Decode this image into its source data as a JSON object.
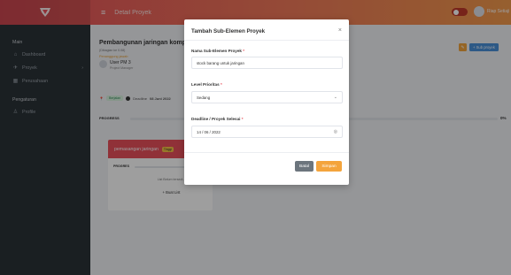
{
  "header": {
    "title": "Detail Proyek",
    "user_name": "Riap Setiaji"
  },
  "sidebar": {
    "sections": [
      "Main",
      "Pengaturan"
    ],
    "items": [
      {
        "label": "Dashboard",
        "icon": "home-icon"
      },
      {
        "label": "Proyek",
        "icon": "rocket-icon"
      },
      {
        "label": "Perusahaan",
        "icon": "building-icon"
      },
      {
        "label": "Profile",
        "icon": "user-icon"
      }
    ]
  },
  "main": {
    "project_title": "Pembangunan jaringan komput",
    "project_sub": "(Dibagian ke 0.08)",
    "manager_label": "Penanggung jawab",
    "manager_name": "User PM 3",
    "manager_role": "Project Manager",
    "status": "Berjalan",
    "deadline_prefix": "Deadline",
    "deadline": "08 Juni 2022",
    "progress_label": "PROGRESS",
    "progress_pct": "0%",
    "progress_value": 0,
    "add_sub_button": "+ Sub proyek",
    "card": {
      "title": "pemasangan jaringan",
      "tag": "Tinggi",
      "progress_label": "PROGRES",
      "empty_text": "List Belum tersedi...",
      "add_list": "+ Buat List"
    }
  },
  "modal": {
    "title": "Tambah Sub-Elemen Proyek",
    "close": "×",
    "name_label": "Nama Sub-Elemen Proyek",
    "name_value": "stock barang untuk jaringan",
    "priority_label": "Level Prioritas",
    "priority_value": "Sedang",
    "deadline_label": "Deadline / Proyek Selesai",
    "deadline_value": "14 / 06 / 2022",
    "required_mark": "*",
    "cancel_label": "Batal",
    "save_label": "Simpan"
  },
  "colors": {
    "header_start": "#e8505b",
    "header_end": "#f39a4c",
    "sidebar_bg": "#2b3238",
    "save_button": "#f4a43c",
    "cancel_button": "#6c757d"
  }
}
